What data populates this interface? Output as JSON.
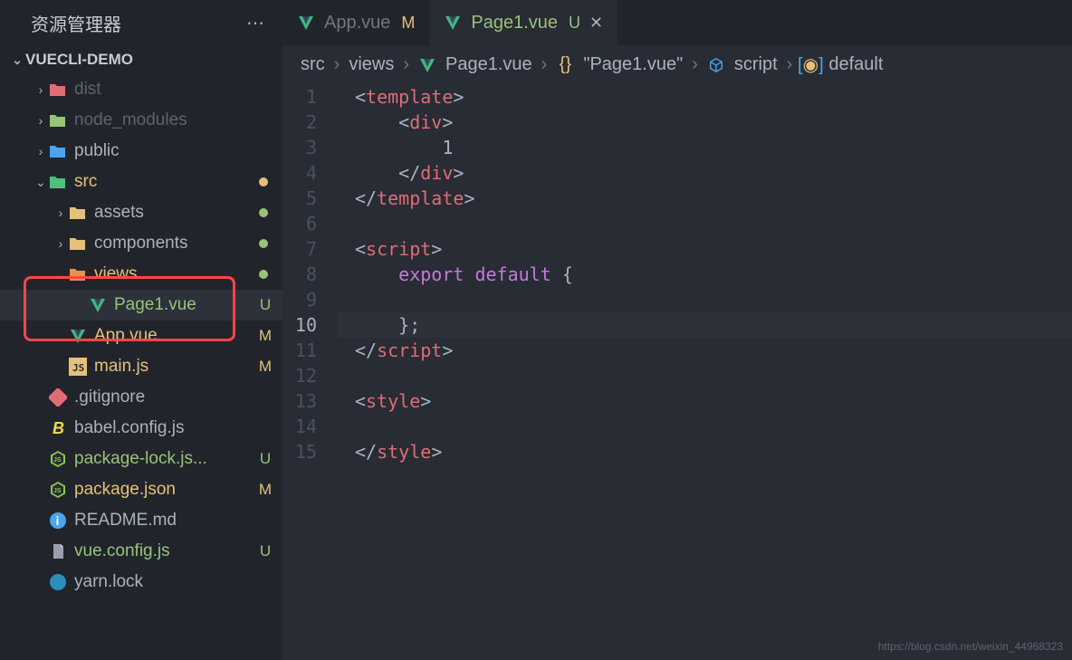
{
  "sidebar": {
    "title": "资源管理器",
    "project": "VUECLI-DEMO",
    "items": [
      {
        "label": "dist",
        "type": "folder",
        "color": "dim",
        "icon": "folder-red",
        "chev": "right",
        "indent": 1
      },
      {
        "label": "node_modules",
        "type": "folder",
        "color": "dim",
        "icon": "folder-green",
        "chev": "right",
        "indent": 1
      },
      {
        "label": "public",
        "type": "folder",
        "icon": "folder-blue",
        "chev": "right",
        "indent": 1
      },
      {
        "label": "src",
        "type": "folder",
        "color": "yellow",
        "icon": "folder-src",
        "chev": "down",
        "indent": 1,
        "dot": "yellow"
      },
      {
        "label": "assets",
        "type": "folder",
        "icon": "folder-yellow",
        "chev": "right",
        "indent": 2,
        "dot": "green"
      },
      {
        "label": "components",
        "type": "folder",
        "icon": "folder-yellow",
        "chev": "right",
        "indent": 2,
        "dot": "green"
      },
      {
        "label": "views",
        "type": "folder",
        "color": "yellow",
        "icon": "folder-orange",
        "chev": "down",
        "indent": 2,
        "dot": "green"
      },
      {
        "label": "Page1.vue",
        "type": "file",
        "color": "green",
        "icon": "vue",
        "indent": 3,
        "status": "U",
        "active": true
      },
      {
        "label": "App.vue",
        "type": "file",
        "color": "yellow",
        "icon": "vue",
        "indent": 2,
        "status": "M"
      },
      {
        "label": "main.js",
        "type": "file",
        "color": "yellow",
        "icon": "js",
        "indent": 2,
        "status": "M"
      },
      {
        "label": ".gitignore",
        "type": "file",
        "icon": "git",
        "indent": 1
      },
      {
        "label": "babel.config.js",
        "type": "file",
        "icon": "babel",
        "indent": 1
      },
      {
        "label": "package-lock.js...",
        "type": "file",
        "color": "green",
        "icon": "node",
        "indent": 1,
        "status": "U"
      },
      {
        "label": "package.json",
        "type": "file",
        "color": "yellow",
        "icon": "node",
        "indent": 1,
        "status": "M"
      },
      {
        "label": "README.md",
        "type": "file",
        "icon": "info",
        "indent": 1
      },
      {
        "label": "vue.config.js",
        "type": "file",
        "color": "green",
        "icon": "vueconf",
        "indent": 1,
        "status": "U"
      },
      {
        "label": "yarn.lock",
        "type": "file",
        "icon": "yarn",
        "indent": 1
      }
    ]
  },
  "tabs": [
    {
      "label": "App.vue",
      "status": "M",
      "active": false
    },
    {
      "label": "Page1.vue",
      "status": "U",
      "active": true,
      "close": true
    }
  ],
  "breadcrumb": {
    "parts": [
      "src",
      "views",
      "Page1.vue",
      "\"Page1.vue\"",
      "script",
      "default"
    ]
  },
  "code": {
    "lines": [
      {
        "n": "1",
        "html": "<span class='tk-pun'>&lt;</span><span class='tk-tag'>template</span><span class='tk-pun'>&gt;</span>"
      },
      {
        "n": "2",
        "html": "    <span class='tk-pun'>&lt;</span><span class='tk-tag'>div</span><span class='tk-pun'>&gt;</span>"
      },
      {
        "n": "3",
        "html": "        1"
      },
      {
        "n": "4",
        "html": "    <span class='tk-pun'>&lt;/</span><span class='tk-tag'>div</span><span class='tk-pun'>&gt;</span>"
      },
      {
        "n": "5",
        "html": "<span class='tk-pun'>&lt;/</span><span class='tk-tag'>template</span><span class='tk-pun'>&gt;</span>"
      },
      {
        "n": "6",
        "html": ""
      },
      {
        "n": "7",
        "html": "<span class='tk-pun'>&lt;</span><span class='tk-tag'>script</span><span class='tk-pun'>&gt;</span>"
      },
      {
        "n": "8",
        "html": "    <span class='tk-key'>export</span> <span class='tk-key'>default</span> <span class='tk-pun'>{</span>"
      },
      {
        "n": "9",
        "html": ""
      },
      {
        "n": "10",
        "html": "    <span class='tk-pun'>};</span>",
        "hl": true
      },
      {
        "n": "11",
        "html": "<span class='tk-pun'>&lt;/</span><span class='tk-tag'>script</span><span class='tk-pun'>&gt;</span>"
      },
      {
        "n": "12",
        "html": ""
      },
      {
        "n": "13",
        "html": "<span class='tk-pun'>&lt;</span><span class='tk-tag'>style</span><span class='tk-pun'>&gt;</span>"
      },
      {
        "n": "14",
        "html": ""
      },
      {
        "n": "15",
        "html": "<span class='tk-pun'>&lt;/</span><span class='tk-tag'>style</span><span class='tk-pun'>&gt;</span>"
      }
    ]
  },
  "watermark": "https://blog.csdn.net/weixin_44968323"
}
